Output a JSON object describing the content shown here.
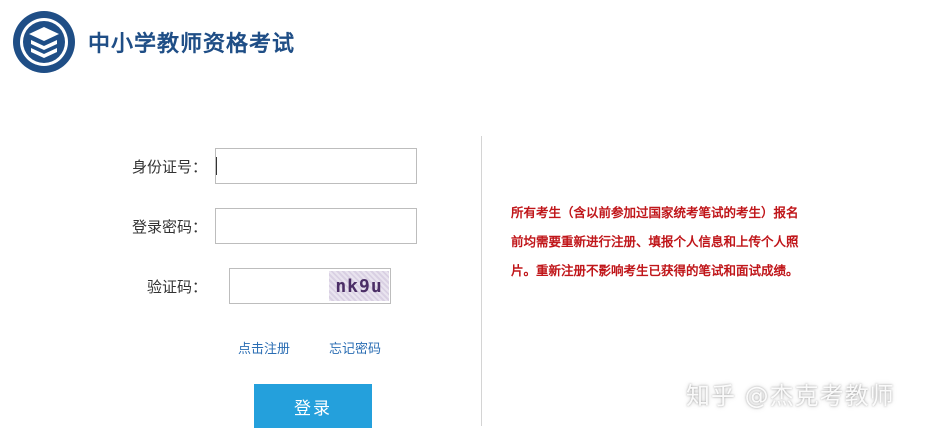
{
  "header": {
    "title": "中小学教师资格考试"
  },
  "form": {
    "id_label": "身份证号：",
    "id_value": "",
    "password_label": "登录密码：",
    "password_value": "",
    "captcha_label": "验证码：",
    "captcha_value": "",
    "captcha_text": "nk9u"
  },
  "links": {
    "register": "点击注册",
    "forgot_password": "忘记密码"
  },
  "login_button": "登录",
  "notice": "所有考生（含以前参加过国家统考笔试的考生）报名前均需要重新进行注册、填报个人信息和上传个人照片。重新注册不影响考生已获得的笔试和面试成绩。",
  "watermark": "知乎 @杰克考教师",
  "colors": {
    "brand": "#1f4e86",
    "button": "#24a0dc",
    "link": "#2a6db3",
    "notice": "#c0161a"
  }
}
